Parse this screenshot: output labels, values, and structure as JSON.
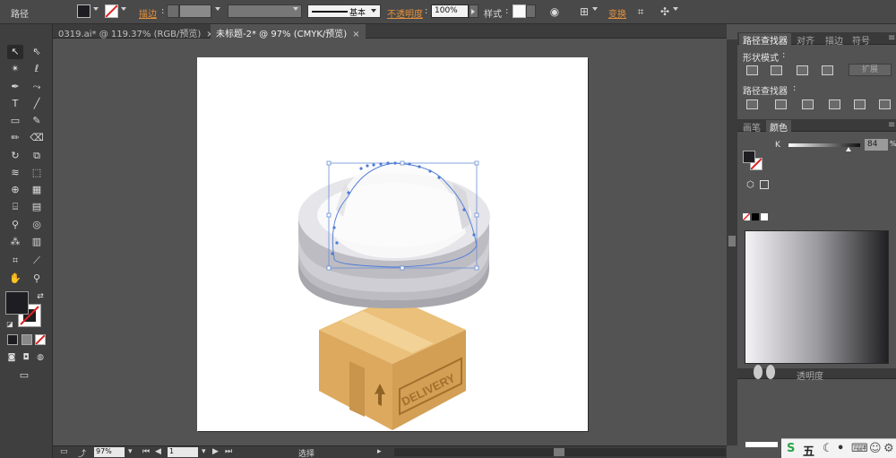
{
  "topbar": {
    "path_label": "路径",
    "stroke_label": "描边",
    "stroke_profile": "基本",
    "opacity_label": "不透明度",
    "opacity_value": "100%",
    "style_label": "样式",
    "transform_label": "变换",
    "accent_orange": "#e8913a"
  },
  "tabs": [
    {
      "label": "0319.ai* @ 119.37% (RGB/预览)",
      "active": false
    },
    {
      "label": "未标题-2* @ 97% (CMYK/预览)",
      "active": true
    }
  ],
  "close_glyph": "×",
  "panels": {
    "pathfinder_tabs": [
      "路径查找器",
      "对齐",
      "描边",
      "符号"
    ],
    "shape_modes_label": "形状模式",
    "expand_label": "扩展",
    "pathfinders_label": "路径查找器",
    "color_tabs": [
      "画笔",
      "颜色"
    ],
    "k_label": "K",
    "k_value": "84",
    "percent": "%",
    "transparency_label": "透明度"
  },
  "status": {
    "zoom": "97%",
    "page": "1",
    "mode": "选择"
  },
  "ime": {
    "five": "五"
  },
  "artwork": {
    "delivery_text": "DELIVERY"
  }
}
